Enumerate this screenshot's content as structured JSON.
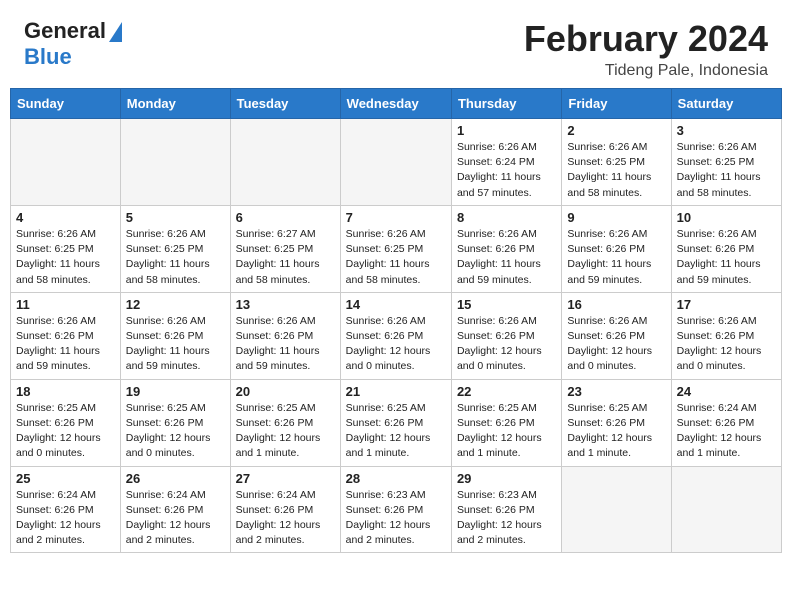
{
  "header": {
    "logo_general": "General",
    "logo_blue": "Blue",
    "month_year": "February 2024",
    "location": "Tideng Pale, Indonesia"
  },
  "days_of_week": [
    "Sunday",
    "Monday",
    "Tuesday",
    "Wednesday",
    "Thursday",
    "Friday",
    "Saturday"
  ],
  "weeks": [
    [
      {
        "num": "",
        "info": ""
      },
      {
        "num": "",
        "info": ""
      },
      {
        "num": "",
        "info": ""
      },
      {
        "num": "",
        "info": ""
      },
      {
        "num": "1",
        "info": "Sunrise: 6:26 AM\nSunset: 6:24 PM\nDaylight: 11 hours\nand 57 minutes."
      },
      {
        "num": "2",
        "info": "Sunrise: 6:26 AM\nSunset: 6:25 PM\nDaylight: 11 hours\nand 58 minutes."
      },
      {
        "num": "3",
        "info": "Sunrise: 6:26 AM\nSunset: 6:25 PM\nDaylight: 11 hours\nand 58 minutes."
      }
    ],
    [
      {
        "num": "4",
        "info": "Sunrise: 6:26 AM\nSunset: 6:25 PM\nDaylight: 11 hours\nand 58 minutes."
      },
      {
        "num": "5",
        "info": "Sunrise: 6:26 AM\nSunset: 6:25 PM\nDaylight: 11 hours\nand 58 minutes."
      },
      {
        "num": "6",
        "info": "Sunrise: 6:27 AM\nSunset: 6:25 PM\nDaylight: 11 hours\nand 58 minutes."
      },
      {
        "num": "7",
        "info": "Sunrise: 6:26 AM\nSunset: 6:25 PM\nDaylight: 11 hours\nand 58 minutes."
      },
      {
        "num": "8",
        "info": "Sunrise: 6:26 AM\nSunset: 6:26 PM\nDaylight: 11 hours\nand 59 minutes."
      },
      {
        "num": "9",
        "info": "Sunrise: 6:26 AM\nSunset: 6:26 PM\nDaylight: 11 hours\nand 59 minutes."
      },
      {
        "num": "10",
        "info": "Sunrise: 6:26 AM\nSunset: 6:26 PM\nDaylight: 11 hours\nand 59 minutes."
      }
    ],
    [
      {
        "num": "11",
        "info": "Sunrise: 6:26 AM\nSunset: 6:26 PM\nDaylight: 11 hours\nand 59 minutes."
      },
      {
        "num": "12",
        "info": "Sunrise: 6:26 AM\nSunset: 6:26 PM\nDaylight: 11 hours\nand 59 minutes."
      },
      {
        "num": "13",
        "info": "Sunrise: 6:26 AM\nSunset: 6:26 PM\nDaylight: 11 hours\nand 59 minutes."
      },
      {
        "num": "14",
        "info": "Sunrise: 6:26 AM\nSunset: 6:26 PM\nDaylight: 12 hours\nand 0 minutes."
      },
      {
        "num": "15",
        "info": "Sunrise: 6:26 AM\nSunset: 6:26 PM\nDaylight: 12 hours\nand 0 minutes."
      },
      {
        "num": "16",
        "info": "Sunrise: 6:26 AM\nSunset: 6:26 PM\nDaylight: 12 hours\nand 0 minutes."
      },
      {
        "num": "17",
        "info": "Sunrise: 6:26 AM\nSunset: 6:26 PM\nDaylight: 12 hours\nand 0 minutes."
      }
    ],
    [
      {
        "num": "18",
        "info": "Sunrise: 6:25 AM\nSunset: 6:26 PM\nDaylight: 12 hours\nand 0 minutes."
      },
      {
        "num": "19",
        "info": "Sunrise: 6:25 AM\nSunset: 6:26 PM\nDaylight: 12 hours\nand 0 minutes."
      },
      {
        "num": "20",
        "info": "Sunrise: 6:25 AM\nSunset: 6:26 PM\nDaylight: 12 hours\nand 1 minute."
      },
      {
        "num": "21",
        "info": "Sunrise: 6:25 AM\nSunset: 6:26 PM\nDaylight: 12 hours\nand 1 minute."
      },
      {
        "num": "22",
        "info": "Sunrise: 6:25 AM\nSunset: 6:26 PM\nDaylight: 12 hours\nand 1 minute."
      },
      {
        "num": "23",
        "info": "Sunrise: 6:25 AM\nSunset: 6:26 PM\nDaylight: 12 hours\nand 1 minute."
      },
      {
        "num": "24",
        "info": "Sunrise: 6:24 AM\nSunset: 6:26 PM\nDaylight: 12 hours\nand 1 minute."
      }
    ],
    [
      {
        "num": "25",
        "info": "Sunrise: 6:24 AM\nSunset: 6:26 PM\nDaylight: 12 hours\nand 2 minutes."
      },
      {
        "num": "26",
        "info": "Sunrise: 6:24 AM\nSunset: 6:26 PM\nDaylight: 12 hours\nand 2 minutes."
      },
      {
        "num": "27",
        "info": "Sunrise: 6:24 AM\nSunset: 6:26 PM\nDaylight: 12 hours\nand 2 minutes."
      },
      {
        "num": "28",
        "info": "Sunrise: 6:23 AM\nSunset: 6:26 PM\nDaylight: 12 hours\nand 2 minutes."
      },
      {
        "num": "29",
        "info": "Sunrise: 6:23 AM\nSunset: 6:26 PM\nDaylight: 12 hours\nand 2 minutes."
      },
      {
        "num": "",
        "info": ""
      },
      {
        "num": "",
        "info": ""
      }
    ]
  ]
}
